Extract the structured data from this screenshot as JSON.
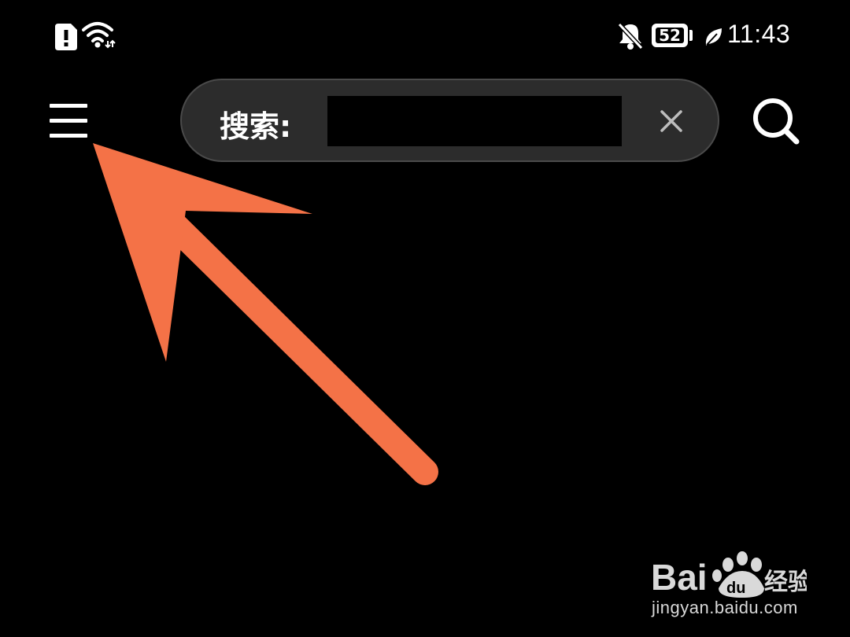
{
  "status_bar": {
    "battery_level": "52",
    "time": "11:43"
  },
  "toolbar": {
    "search_label": "搜索:",
    "search_value": "",
    "search_placeholder": ""
  },
  "watermark": {
    "url": "jingyan.baidu.com"
  },
  "colors": {
    "background": "#000000",
    "search_bar": "#2c2c2c",
    "arrow": "#f47247",
    "icon": "#ffffff"
  }
}
